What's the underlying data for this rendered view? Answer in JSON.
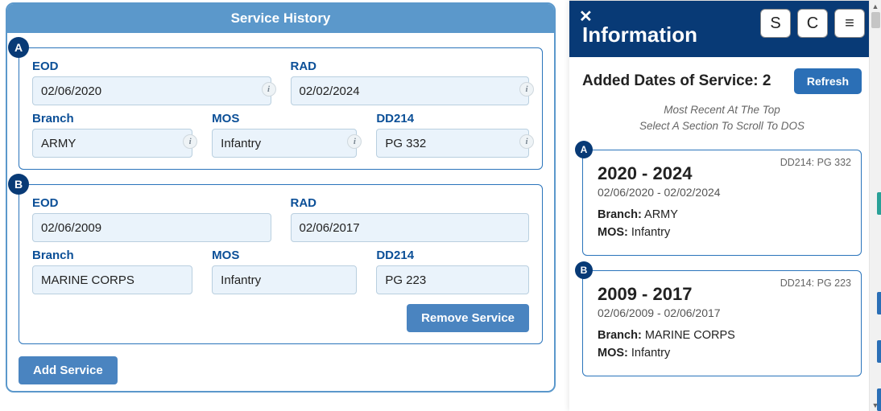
{
  "left": {
    "title": "Service History",
    "add_label": "Add Service",
    "remove_label": "Remove Service",
    "labels": {
      "eod": "EOD",
      "rad": "RAD",
      "branch": "Branch",
      "mos": "MOS",
      "dd214": "DD214"
    },
    "sections": [
      {
        "letter": "A",
        "eod": "02/06/2020",
        "rad": "02/02/2024",
        "branch": "ARMY",
        "mos": "Infantry",
        "dd214": "PG 332",
        "show_remove": false,
        "show_infodots": true
      },
      {
        "letter": "B",
        "eod": "02/06/2009",
        "rad": "02/06/2017",
        "branch": "MARINE CORPS",
        "mos": "Infantry",
        "dd214": "PG 223",
        "show_remove": true,
        "show_infodots": false
      }
    ]
  },
  "right": {
    "title": "Information",
    "buttons": {
      "s": "S",
      "c": "C",
      "menu": "≡"
    },
    "summary_prefix": "Added Dates of Service: ",
    "summary_count": "2",
    "refresh": "Refresh",
    "hint1": "Most Recent At The Top",
    "hint2": "Select A Section To Scroll To DOS",
    "branch_label": "Branch:",
    "mos_label": "MOS:",
    "dd214_prefix": "DD214: ",
    "cards": [
      {
        "letter": "A",
        "dd214": "PG 332",
        "years": "2020 - 2024",
        "dates": "02/06/2020 - 02/02/2024",
        "branch": "ARMY",
        "mos": "Infantry"
      },
      {
        "letter": "B",
        "dd214": "PG 223",
        "years": "2009 - 2017",
        "dates": "02/06/2009 - 02/06/2017",
        "branch": "MARINE CORPS",
        "mos": "Infantry"
      }
    ]
  },
  "accent_tabs": [
    "#2aa198",
    "#2b6fb6",
    "#2b6fb6",
    "#2b6fb6"
  ]
}
